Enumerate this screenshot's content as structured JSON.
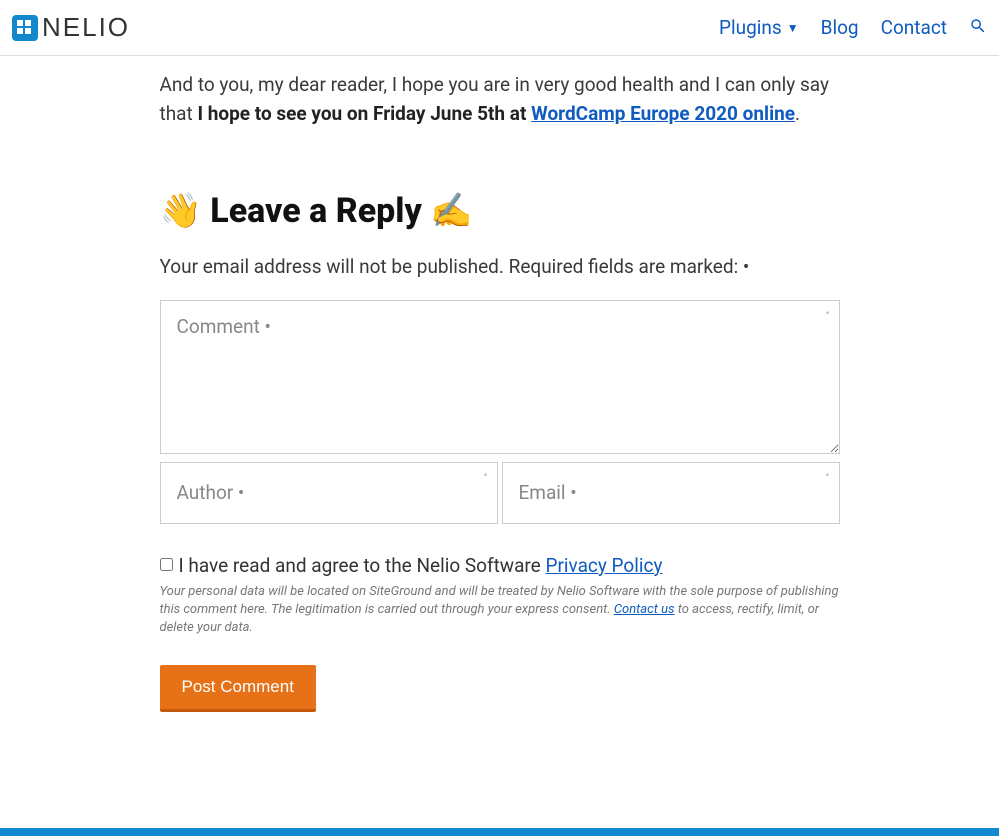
{
  "header": {
    "logo_text": "NELIO",
    "nav": {
      "plugins": "Plugins",
      "blog": "Blog",
      "contact": "Contact"
    }
  },
  "article": {
    "lead_in": "And to you, my dear reader, I hope you are in very good health and I can only say that ",
    "bold_part": "I hope to see you on Friday June 5th at ",
    "link_text": "WordCamp Europe 2020 online",
    "trailing": "."
  },
  "reply": {
    "heading": "👋 Leave a Reply ✍️",
    "subtext": "Your email address will not be published. Required fields are marked: •",
    "comment_placeholder": "Comment •",
    "author_placeholder": "Author •",
    "email_placeholder": "Email •",
    "consent_prefix": "I have read and agree to the Nelio Software ",
    "consent_link": "Privacy Policy",
    "privacy_note_1": "Your personal data will be located on SiteGround and will be treated by Nelio Software with the sole purpose of publishing this comment here. The legitimation is carried out through your express consent. ",
    "privacy_contact": "Contact us",
    "privacy_note_2": " to access, rectify, limit, or delete your data.",
    "submit_label": "Post Comment"
  }
}
